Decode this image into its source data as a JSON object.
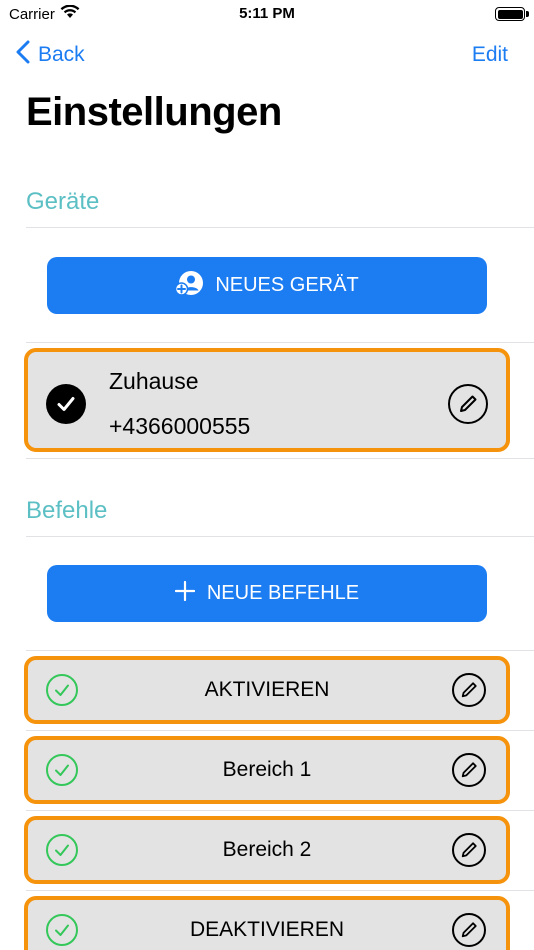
{
  "status_bar": {
    "carrier": "Carrier",
    "time": "5:11 PM"
  },
  "nav": {
    "back_label": "Back",
    "edit_label": "Edit"
  },
  "page_title": "Einstellungen",
  "devices_section": {
    "header": "Geräte",
    "add_button_label": "NEUES GERÄT",
    "items": [
      {
        "name": "Zuhause",
        "number": "+4366000555",
        "selected": true
      }
    ]
  },
  "commands_section": {
    "header": "Befehle",
    "add_button_label": "NEUE BEFEHLE",
    "items": [
      {
        "label": "AKTIVIEREN"
      },
      {
        "label": "Bereich 1"
      },
      {
        "label": "Bereich 2"
      },
      {
        "label": "DEAKTIVIEREN"
      }
    ]
  },
  "colors": {
    "accent": "#1c7cf2",
    "section_header": "#5bbfc4",
    "card_border": "#f6930c",
    "card_background": "#e3e3e3",
    "check_green": "#34c759"
  },
  "icons": {
    "wifi": "wifi-icon",
    "battery": "battery-icon",
    "back": "chevron-left-icon",
    "add_device": "add-person-icon",
    "add_command": "plus-icon",
    "selected": "checkmark-circle-filled-icon",
    "command_check": "checkmark-circle-outline-icon",
    "edit": "pencil-circle-icon"
  }
}
